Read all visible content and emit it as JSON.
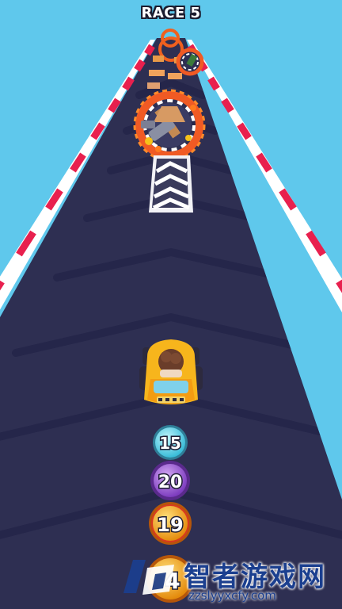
{
  "hud": {
    "title": "RACE 5"
  },
  "player": {
    "kart": "yellow-kart"
  },
  "colors": {
    "sky": "#5fc8ec",
    "track": "#2e2f52",
    "stripe_red": "#e8204e",
    "stripe_white": "#ffffff",
    "orb_cyan": "#59d8ec",
    "orb_purple": "#9b5ad6",
    "orb_orange": "#f3a318"
  },
  "orbs": [
    {
      "value": "15",
      "color": "cyan"
    },
    {
      "value": "20",
      "color": "purple"
    },
    {
      "value": "19",
      "color": "orange"
    },
    {
      "value": "4",
      "color": "orange"
    }
  ],
  "obstacles": [
    {
      "name": "spinning-hammer-fire-ring"
    },
    {
      "name": "small-fire-ring"
    },
    {
      "name": "speed-boost-ramp"
    }
  ],
  "watermark": {
    "text": "智者游戏网",
    "url": "zzslyyxcfy.com"
  }
}
